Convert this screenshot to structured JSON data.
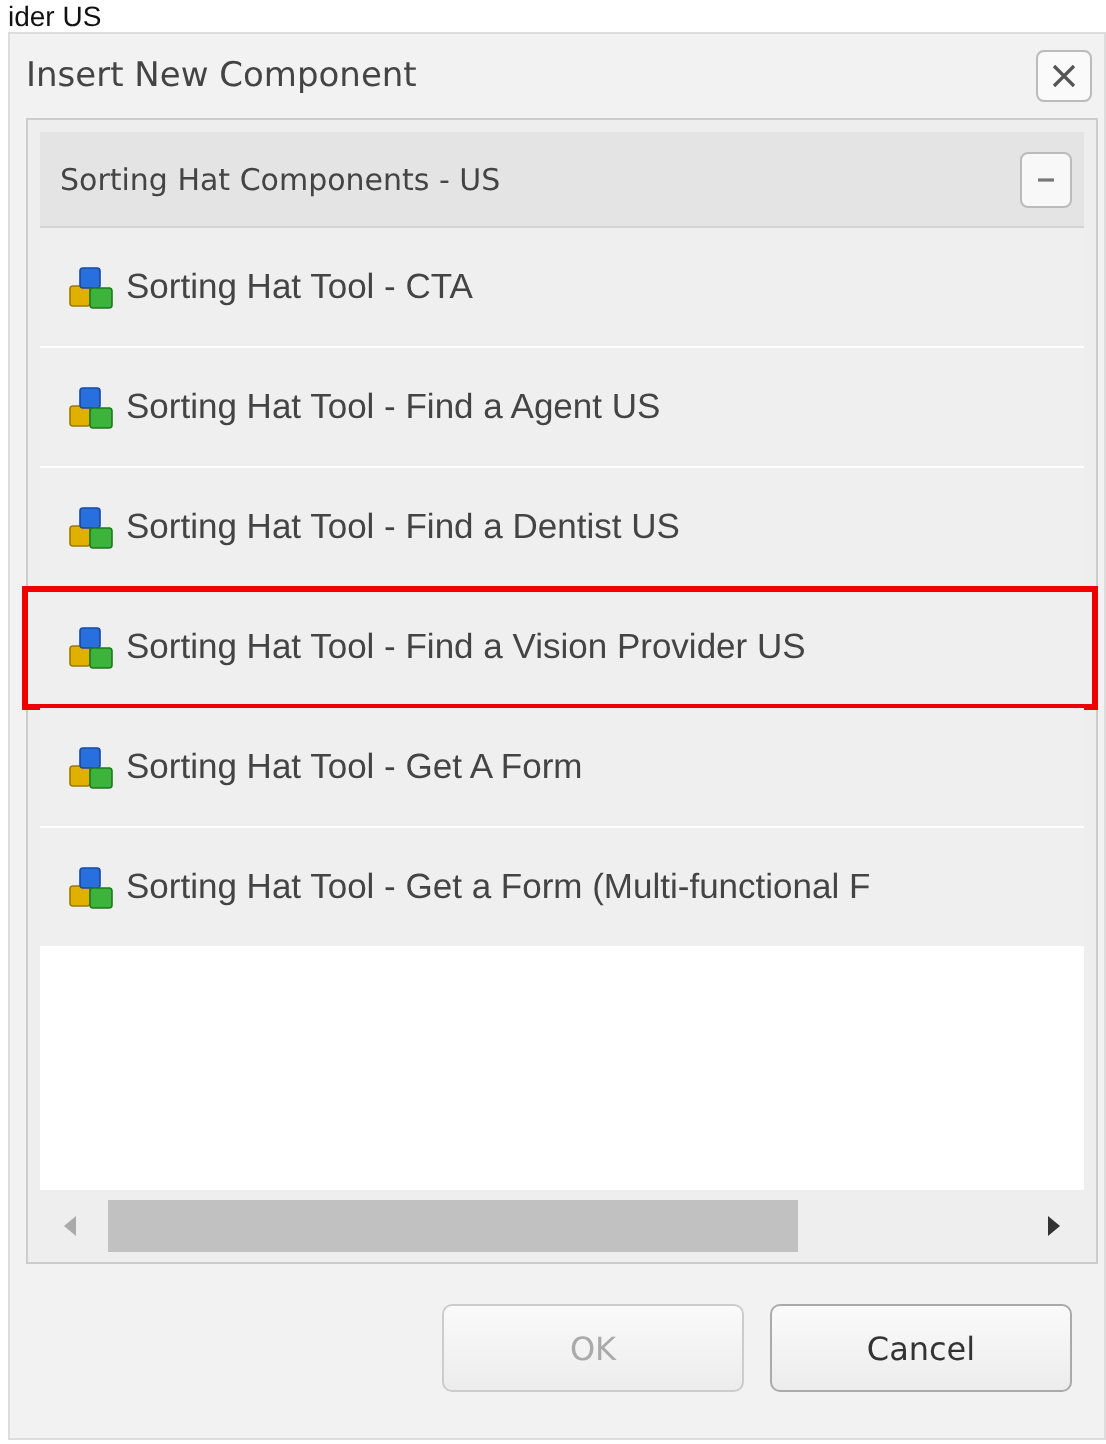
{
  "page_fragment": "ider US",
  "window": {
    "title": "Insert New Component"
  },
  "group": {
    "title": "Sorting Hat Components - US",
    "expanded": true,
    "items": [
      {
        "label": "Sorting Hat Tool - CTA",
        "selected": false
      },
      {
        "label": "Sorting Hat Tool - Find a Agent US",
        "selected": false
      },
      {
        "label": "Sorting Hat Tool - Find a Dentist US",
        "selected": false
      },
      {
        "label": "Sorting Hat Tool - Find a Vision Provider US",
        "selected": true
      },
      {
        "label": "Sorting Hat Tool - Get A Form",
        "selected": false
      },
      {
        "label": "Sorting Hat Tool - Get a Form (Multi-functional F",
        "selected": false
      }
    ]
  },
  "buttons": [
    {
      "label": "OK",
      "disabled": true
    },
    {
      "label": "Cancel",
      "disabled": false
    }
  ]
}
